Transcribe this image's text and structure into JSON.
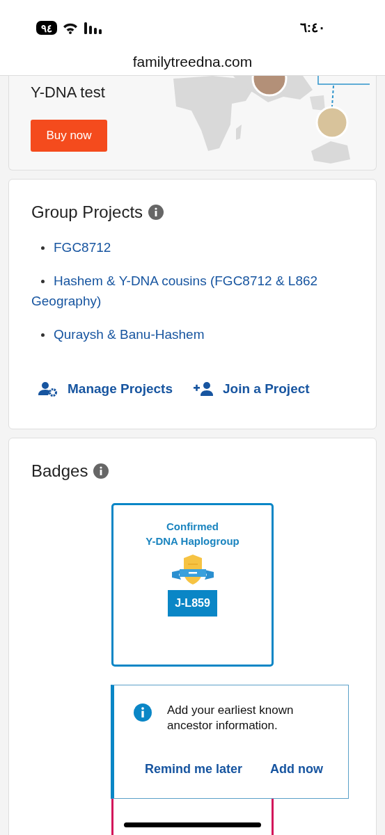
{
  "status_bar": {
    "battery": "٩٤",
    "time": "٦:٤٠"
  },
  "address_bar": {
    "url": "familytreedna.com"
  },
  "promo": {
    "title": "Y-DNA test",
    "button": "Buy now"
  },
  "group_projects": {
    "title": "Group Projects",
    "items": [
      {
        "label": "FGC8712"
      },
      {
        "label": "Hashem & Y-DNA cousins (FGC8712 & L862 Geography)"
      },
      {
        "label": "Quraysh & Banu-Hashem"
      }
    ],
    "actions": [
      {
        "kind": "manage",
        "label": "Manage Projects"
      },
      {
        "kind": "join",
        "label": "Join a Project"
      }
    ]
  },
  "badges": {
    "title": "Badges",
    "items": [
      {
        "kind": "haplogroup",
        "color": "#0a86c6",
        "title": "Confirmed\nY-DNA Haplogroup",
        "value": "J-L859"
      },
      {
        "kind": "blank",
        "color": "#d2145a"
      }
    ]
  },
  "notice": {
    "text": "Add your earliest known ancestor information.",
    "actions": [
      "Remind me later",
      "Add now"
    ]
  }
}
